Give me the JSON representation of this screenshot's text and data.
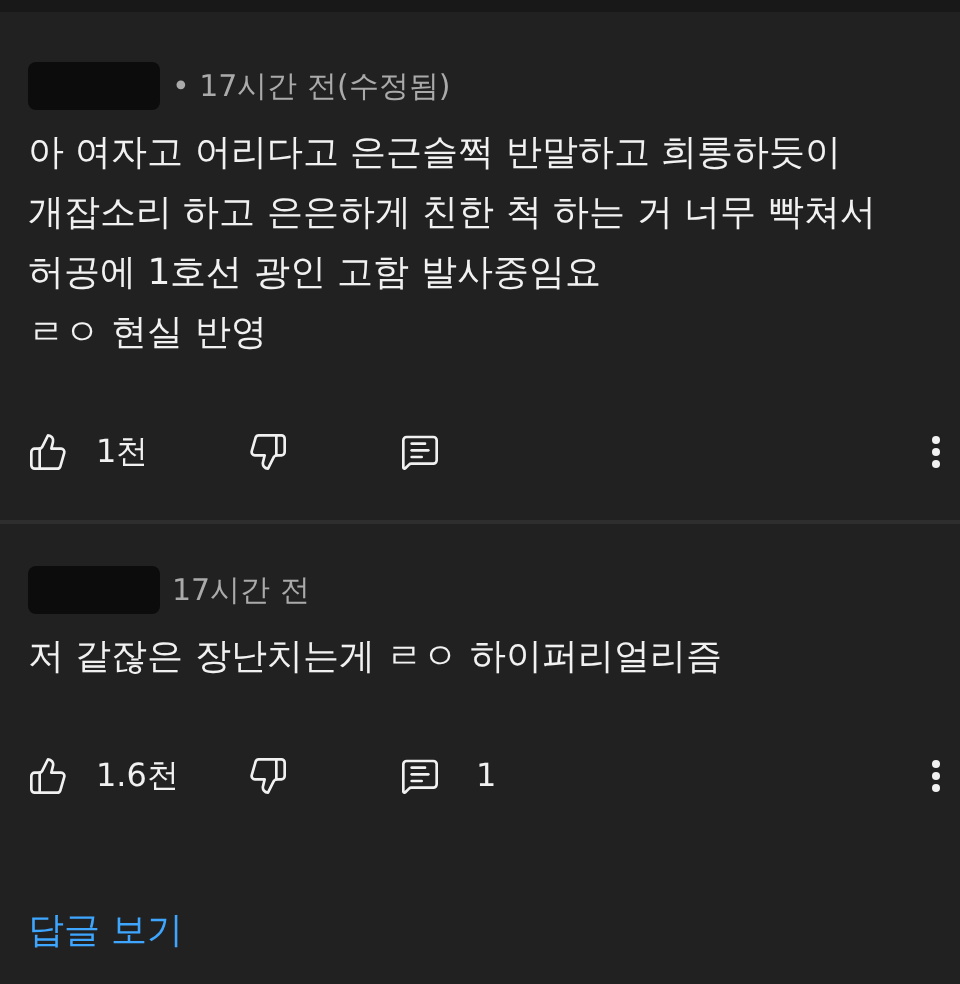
{
  "comments": [
    {
      "meta": "• 17시간 전(수정됨)",
      "body": [
        "아 여자고 어리다고 은근슬쩍 반말하고 희롱하듯이",
        "개잡소리 하고 은은하게 친한 척 하는 거 너무 빡쳐서",
        "허공에 1호선 광인 고함 발사중임요",
        "ㄹㅇ 현실 반영"
      ],
      "likes": "1천"
    },
    {
      "meta": "17시간 전",
      "body": [
        "저 같잖은 장난치는게 ㄹㅇ 하이퍼리얼리즘"
      ],
      "likes": "1.6천",
      "replies": "1"
    }
  ],
  "view_replies": "답글 보기"
}
